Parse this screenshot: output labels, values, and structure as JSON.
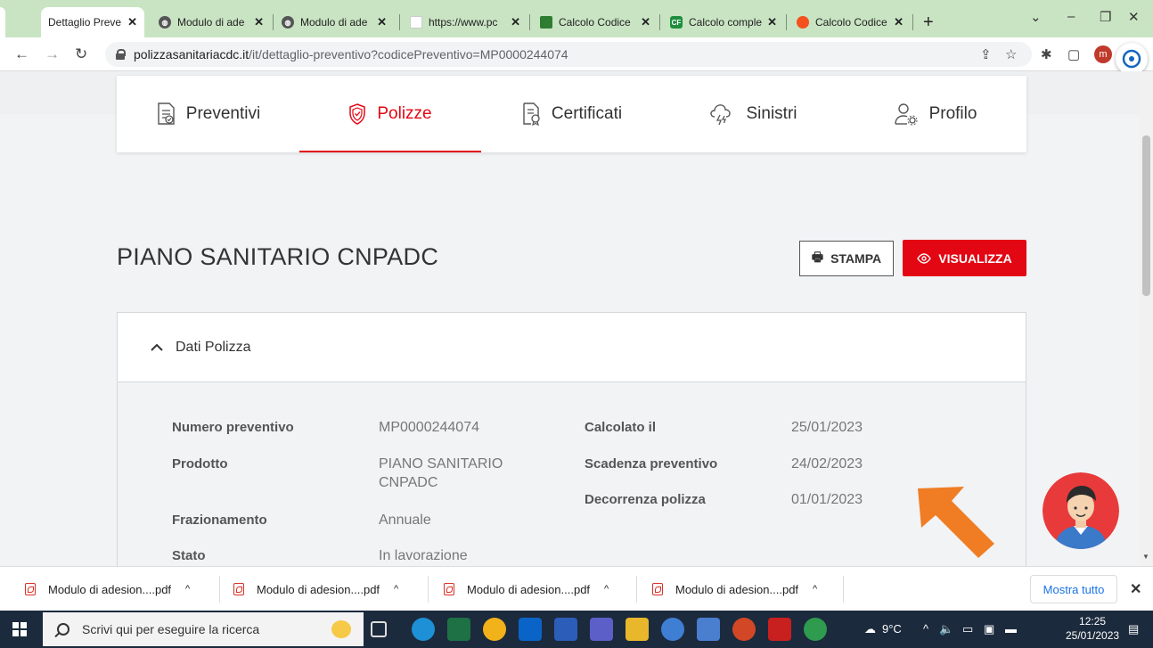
{
  "browser": {
    "tabs": [
      {
        "title": "Dettaglio Preve",
        "active": true,
        "favicon": "page-icon",
        "color": "#ffffff"
      },
      {
        "title": "Modulo di ade",
        "active": false,
        "favicon": "globe-icon",
        "color": "#555555"
      },
      {
        "title": "Modulo di ade",
        "active": false,
        "favicon": "globe-icon",
        "color": "#555555"
      },
      {
        "title": "https://www.pc",
        "active": false,
        "favicon": "blank-page-icon",
        "color": "#ffffff"
      },
      {
        "title": "Calcolo Codice",
        "active": false,
        "favicon": "calendar-icon",
        "color": "#2e7d32"
      },
      {
        "title": "Calcolo comple",
        "active": false,
        "favicon": "cf-icon",
        "color": "#1e8e3e"
      },
      {
        "title": "Calcolo Codice",
        "active": false,
        "favicon": "orange-circle-icon",
        "color": "#f4511e"
      }
    ],
    "cf_glyph": "CF",
    "new_tab": "+",
    "url_host": "polizzasanitariacdc.it",
    "url_path": "/it/dettaglio-preventivo?codicePreventivo=MP0000244074",
    "profile_initial": "m"
  },
  "nav": {
    "items": [
      {
        "label": "Preventivi",
        "icon": "document-check-icon",
        "active": false
      },
      {
        "label": "Polizze",
        "icon": "shield-icon",
        "active": true
      },
      {
        "label": "Certificati",
        "icon": "certificate-icon",
        "active": false
      },
      {
        "label": "Sinistri",
        "icon": "storm-cloud-icon",
        "active": false
      },
      {
        "label": "Profilo",
        "icon": "user-gear-icon",
        "active": false
      }
    ],
    "accent": "#e30613"
  },
  "policy": {
    "title": "PIANO SANITARIO CNPADC",
    "stampa_label": "STAMPA",
    "visualizza_label": "VISUALIZZA"
  },
  "panel": {
    "header": "Dati Polizza",
    "fields": {
      "numero_preventivo": {
        "label": "Numero preventivo",
        "value": "MP0000244074"
      },
      "prodotto": {
        "label": "Prodotto",
        "value_line1": "PIANO SANITARIO",
        "value_line2": "CNPADC"
      },
      "frazionamento": {
        "label": "Frazionamento",
        "value": "Annuale"
      },
      "stato": {
        "label": "Stato",
        "value": "In lavorazione"
      },
      "calcolato_il": {
        "label": "Calcolato il",
        "value": "25/01/2023"
      },
      "scadenza_preventivo": {
        "label": "Scadenza preventivo",
        "value": "24/02/2023"
      },
      "decorrenza_polizza": {
        "label": "Decorrenza polizza",
        "value": "01/01/2023"
      }
    }
  },
  "downloads": {
    "items": [
      "Modulo di adesion....pdf",
      "Modulo di adesion....pdf",
      "Modulo di adesion....pdf",
      "Modulo di adesion....pdf"
    ],
    "show_all": "Mostra tutto"
  },
  "taskbar": {
    "search_placeholder": "Scrivi qui per eseguire la ricerca",
    "weather": "9°C",
    "time": "12:25",
    "date": "25/01/2023"
  }
}
